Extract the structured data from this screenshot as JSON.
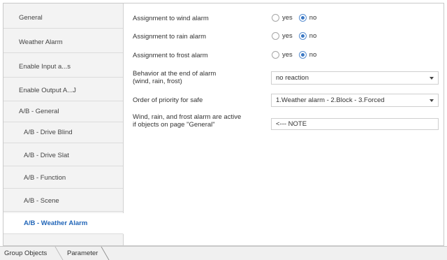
{
  "sidebar": {
    "items": [
      {
        "label": "General"
      },
      {
        "label": "Weather Alarm"
      },
      {
        "label": "Enable Input a...s"
      },
      {
        "label": "Enable Output A...J"
      },
      {
        "label": "A/B - General"
      },
      {
        "label": "A/B - Drive Blind"
      },
      {
        "label": "A/B - Drive Slat"
      },
      {
        "label": "A/B - Function"
      },
      {
        "label": "A/B - Scene"
      },
      {
        "label": "A/B - Weather Alarm"
      }
    ],
    "active_index": 9
  },
  "params": {
    "wind": {
      "label": "Assignment to wind alarm",
      "yes": "yes",
      "no": "no",
      "selected": "no"
    },
    "rain": {
      "label": "Assignment to rain alarm",
      "yes": "yes",
      "no": "no",
      "selected": "no"
    },
    "frost": {
      "label": "Assignment to frost alarm",
      "yes": "yes",
      "no": "no",
      "selected": "no"
    },
    "behavior": {
      "label_line1": "Behavior at the end of alarm",
      "label_line2": "(wind, rain, frost)",
      "value": "no reaction"
    },
    "priority": {
      "label": "Order of priority for safe",
      "value": "1.Weather alarm - 2.Block - 3.Forced"
    },
    "note": {
      "label_line1": "Wind, rain, and frost alarm are active",
      "label_line2": "if objects on page \"General\"",
      "value": "<--- NOTE"
    }
  },
  "tabs": {
    "group_objects": "Group Objects",
    "parameter": "Parameter"
  }
}
